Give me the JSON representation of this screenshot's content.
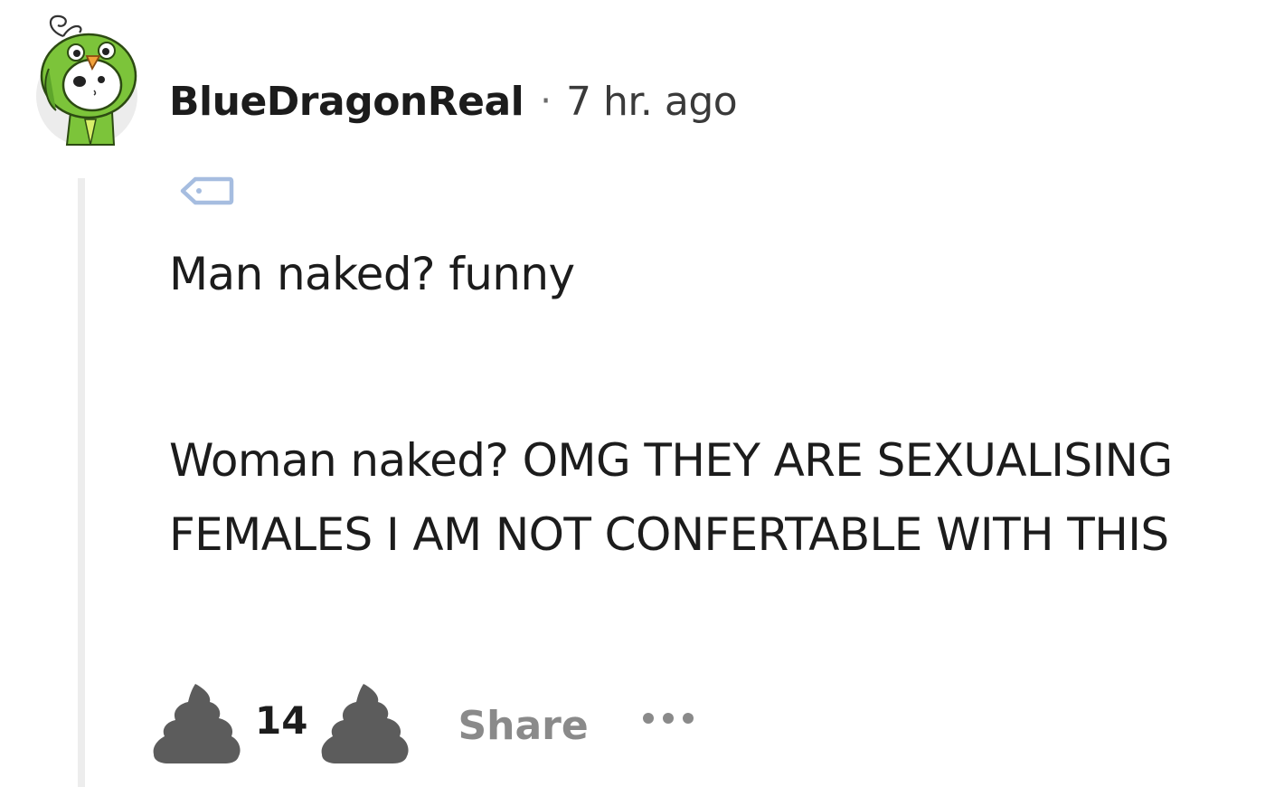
{
  "comment": {
    "author": "BlueDragonReal",
    "separator": "·",
    "timestamp": "7 hr. ago",
    "body_paragraphs": [
      "Man naked? funny",
      "Woman naked? OMG THEY ARE SEXUALISING",
      "FEMALES I AM NOT CONFERTABLE WITH THIS"
    ],
    "score": "14",
    "share_label": "Share"
  },
  "icons": {
    "avatar": "green-bird-costume-avatar-icon",
    "flair": "tag-icon",
    "upvote": "poop-upvote-icon",
    "downvote": "poop-downvote-icon",
    "more": "ellipsis-icon"
  },
  "colors": {
    "text": "#1c1c1c",
    "muted": "#8a8a8a",
    "thread_line": "#ededed",
    "vote_icon": "#5c5c5c",
    "flair_icon": "#a6bde0",
    "avatar_green": "#7cc43a"
  }
}
